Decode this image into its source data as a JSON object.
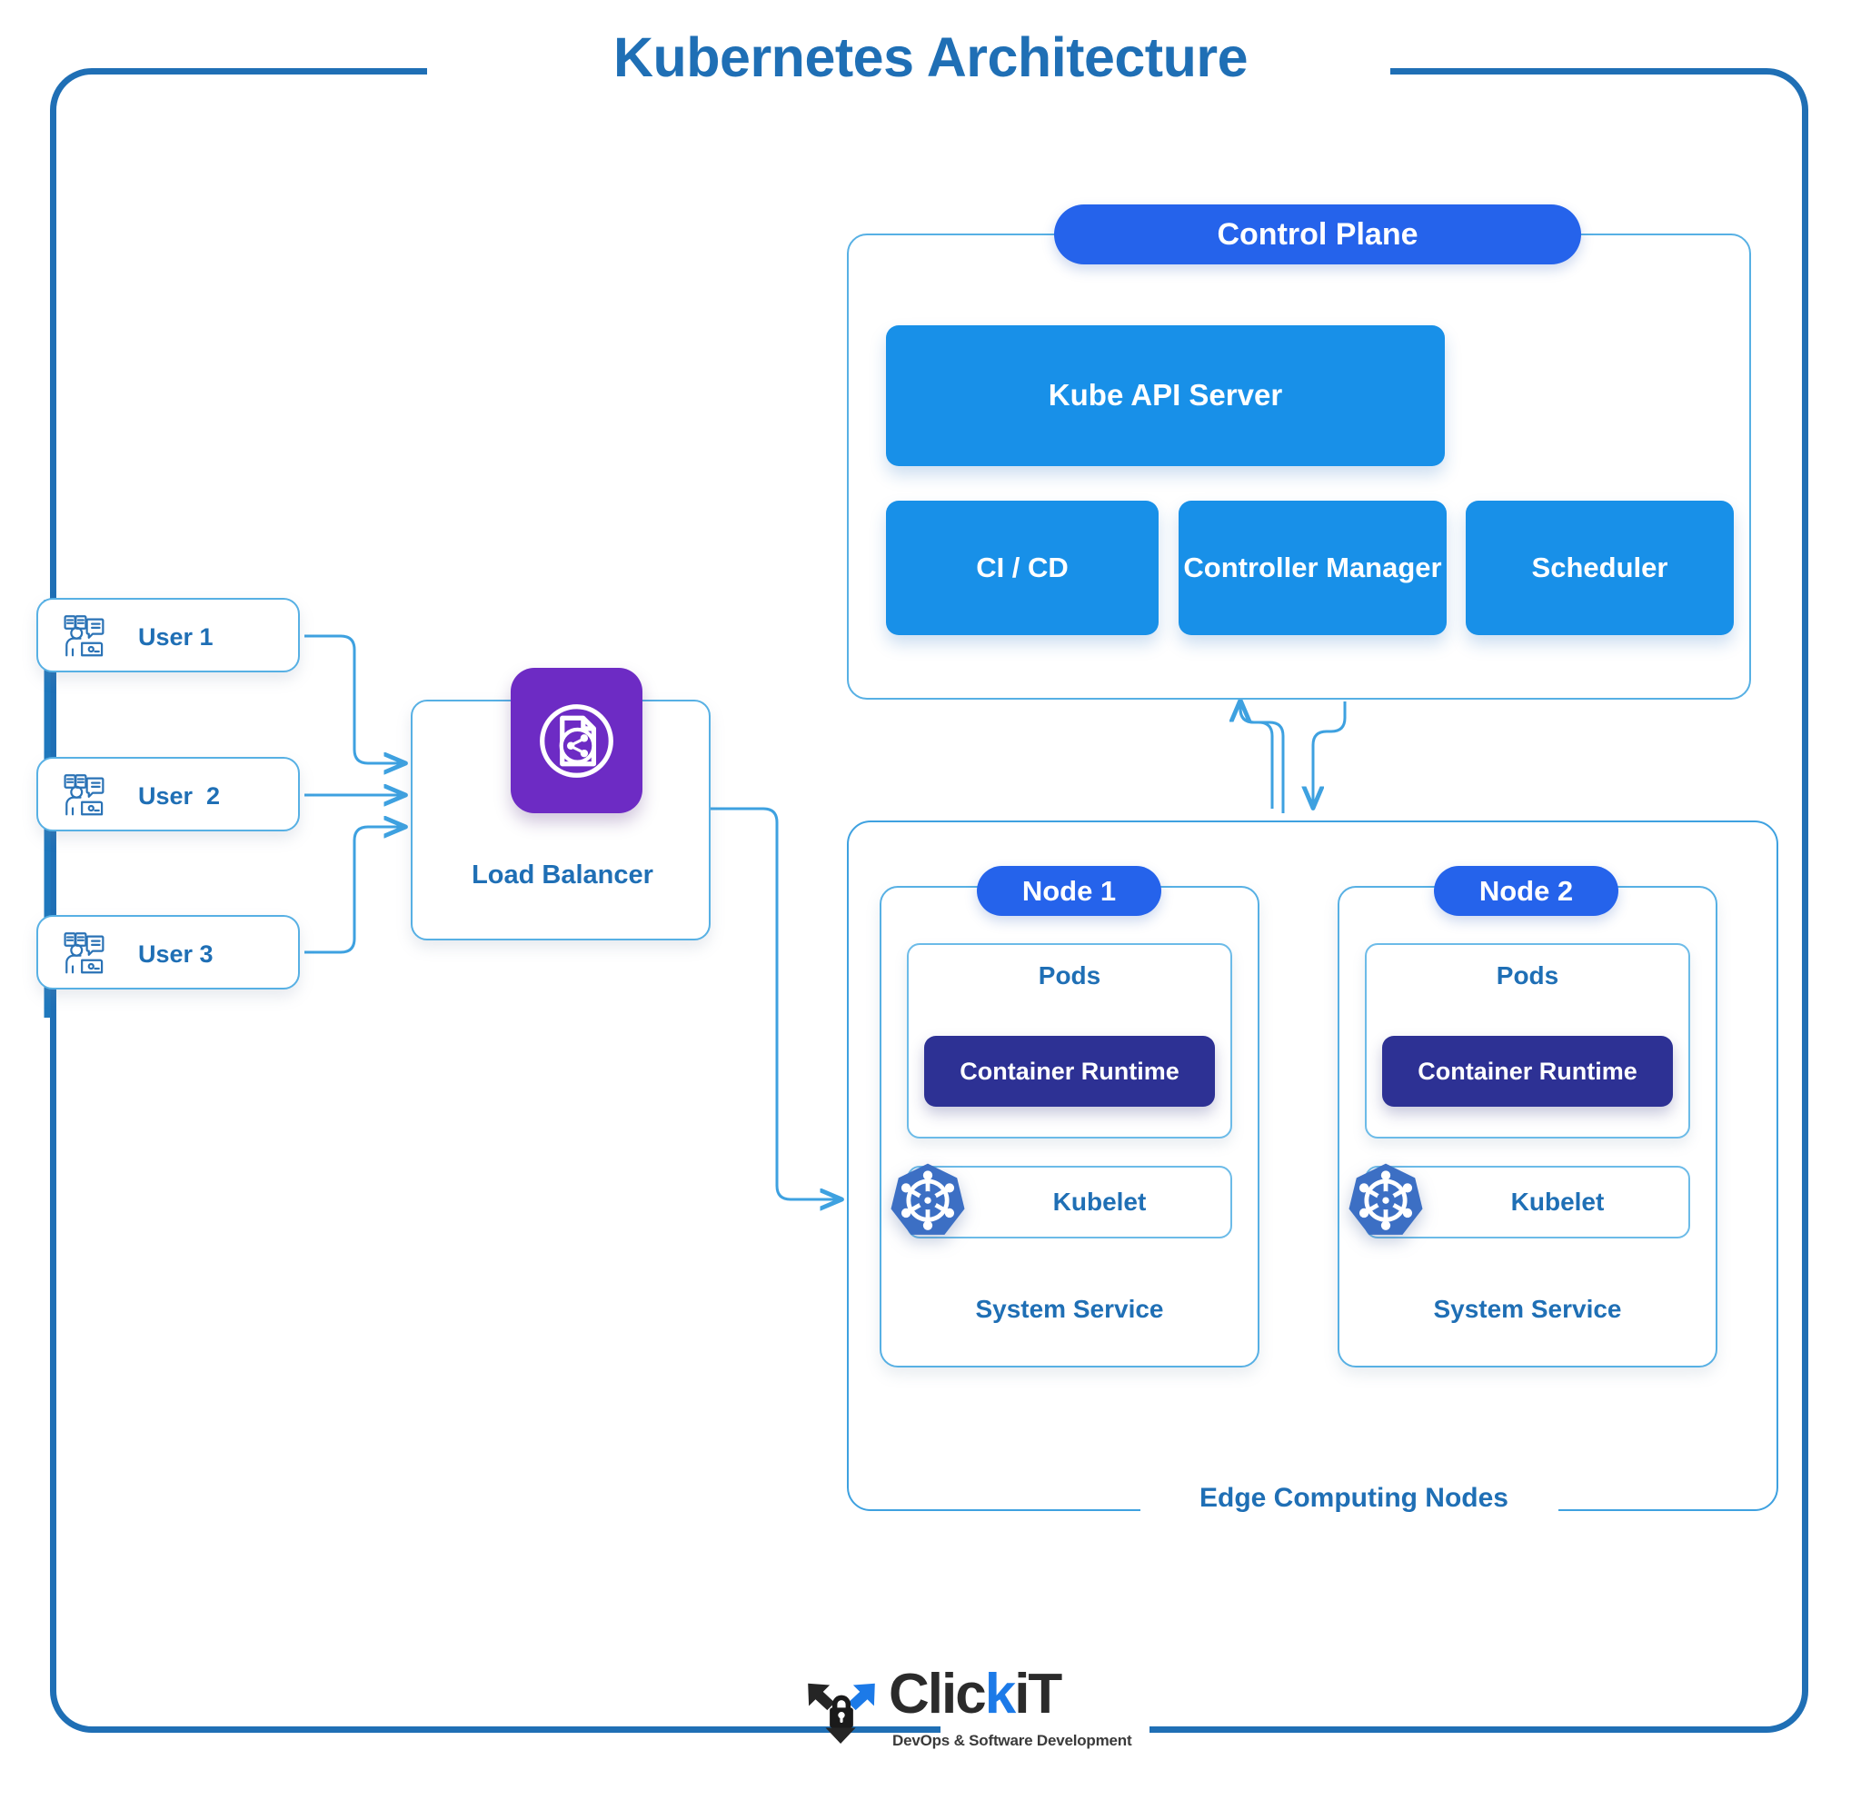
{
  "title": "Kubernetes Architecture",
  "users": [
    {
      "label": "User 1",
      "icon": "user-workstation-icon"
    },
    {
      "label": "User  2",
      "icon": "user-workstation-icon"
    },
    {
      "label": "User 3",
      "icon": "user-workstation-icon"
    }
  ],
  "load_balancer": {
    "label": "Load Balancer",
    "icon": "load-balancer-share-document-icon",
    "icon_color": "#6d2bc4"
  },
  "control_plane": {
    "title": "Control Plane",
    "api_server": "Kube API Server",
    "tiles": [
      {
        "label": "CI / CD"
      },
      {
        "label": "Controller Manager"
      },
      {
        "label": "Scheduler"
      }
    ]
  },
  "edge": {
    "label": "Edge Computing Nodes",
    "nodes": [
      {
        "title": "Node 1",
        "pods_label": "Pods",
        "container_runtime": "Container Runtime",
        "kubelet": "Kubelet",
        "kubelet_icon": "kubernetes-helm-icon",
        "system_service": "System Service"
      },
      {
        "title": "Node 2",
        "pods_label": "Pods",
        "container_runtime": "Container Runtime",
        "kubelet": "Kubelet",
        "kubelet_icon": "kubernetes-helm-icon",
        "system_service": "System Service"
      }
    ]
  },
  "brand": {
    "name_part1": "Clic",
    "name_part2": "k",
    "name_part3": "iT",
    "tagline": "DevOps & Software Development",
    "icon": "clickit-shield-lock-icon"
  },
  "colors": {
    "frame": "#1f6fb5",
    "title": "#1f6fb5",
    "pill": "#2563eb",
    "tile": "#1890e8",
    "runtime": "#2d3194",
    "card_border": "#57b0e4",
    "wire": "#3ea1e0",
    "load_balancer": "#6d2bc4",
    "k8s_logo": "#3c6fc4"
  }
}
